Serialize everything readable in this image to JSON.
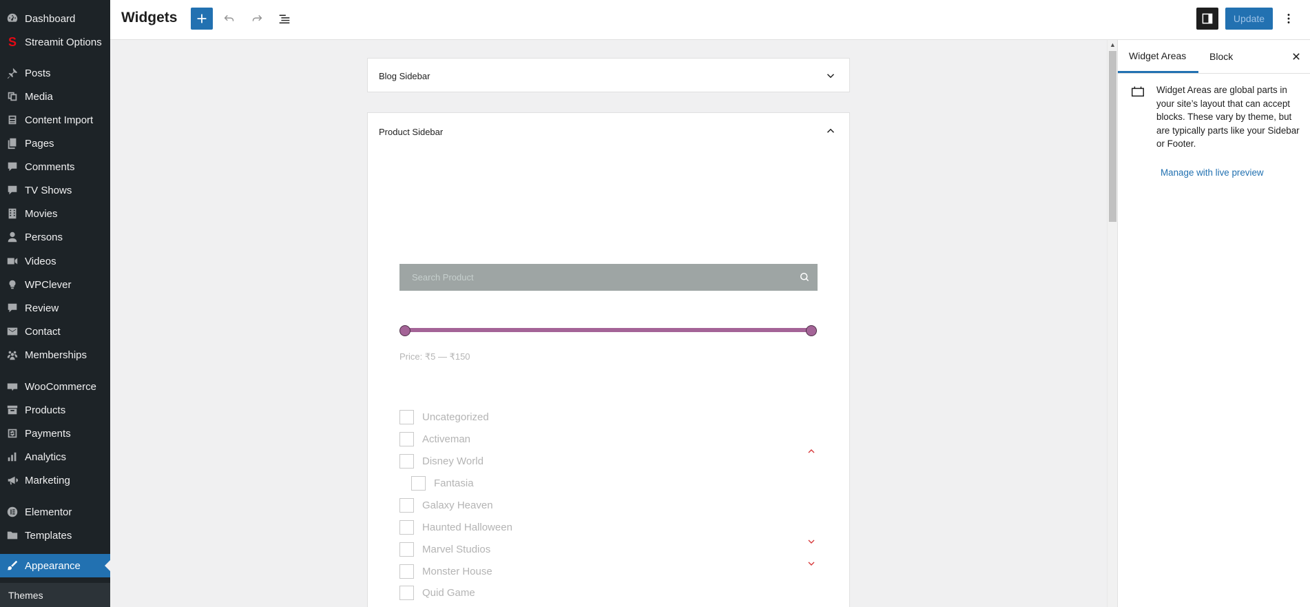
{
  "sidebar": {
    "items": [
      {
        "label": "Dashboard",
        "icon": "dashboard-icon"
      },
      {
        "label": "Streamit Options",
        "icon": "streamit-s-icon"
      },
      {
        "label": "Posts",
        "icon": "pin-icon"
      },
      {
        "label": "Media",
        "icon": "media-icon"
      },
      {
        "label": "Content Import",
        "icon": "import-icon"
      },
      {
        "label": "Pages",
        "icon": "pages-icon"
      },
      {
        "label": "Comments",
        "icon": "comment-icon"
      },
      {
        "label": "TV Shows",
        "icon": "comment-icon"
      },
      {
        "label": "Movies",
        "icon": "film-icon"
      },
      {
        "label": "Persons",
        "icon": "person-icon"
      },
      {
        "label": "Videos",
        "icon": "video-icon"
      },
      {
        "label": "WPClever",
        "icon": "lightbulb-icon"
      },
      {
        "label": "Review",
        "icon": "comment-icon"
      },
      {
        "label": "Contact",
        "icon": "mail-icon"
      },
      {
        "label": "Memberships",
        "icon": "groups-icon"
      },
      {
        "label": "WooCommerce",
        "icon": "woo-icon"
      },
      {
        "label": "Products",
        "icon": "archive-icon"
      },
      {
        "label": "Payments",
        "icon": "dollar-icon"
      },
      {
        "label": "Analytics",
        "icon": "bar-chart-icon"
      },
      {
        "label": "Marketing",
        "icon": "megaphone-icon"
      },
      {
        "label": "Elementor",
        "icon": "elementor-icon"
      },
      {
        "label": "Templates",
        "icon": "folder-icon"
      },
      {
        "label": "Appearance",
        "icon": "paintbrush-icon",
        "active": true
      }
    ],
    "submenu": {
      "label": "Themes"
    }
  },
  "header": {
    "title": "Widgets",
    "update_label": "Update"
  },
  "widget_areas": [
    {
      "title": "Blog Sidebar",
      "expanded": false
    },
    {
      "title": "Product Sidebar",
      "expanded": true
    }
  ],
  "product_sidebar": {
    "search_placeholder": "Search Product",
    "price_filter": {
      "label": "Price: ₹5 — ₹150",
      "min": 5,
      "max": 150
    },
    "categories": [
      {
        "label": "Uncategorized"
      },
      {
        "label": "Activeman"
      },
      {
        "label": "Disney World",
        "expanded": true
      },
      {
        "label": "Fantasia",
        "child": true
      },
      {
        "label": "Galaxy Heaven"
      },
      {
        "label": "Haunted Halloween"
      },
      {
        "label": "Marvel Studios",
        "has_children": true
      },
      {
        "label": "Monster House",
        "has_children": true
      },
      {
        "label": "Quid Game"
      }
    ]
  },
  "settings_panel": {
    "tabs": [
      {
        "label": "Widget Areas",
        "active": true
      },
      {
        "label": "Block",
        "active": false
      }
    ],
    "description": "Widget Areas are global parts in your site’s layout that can accept blocks. These vary by theme, but are typically parts like your Sidebar or Footer.",
    "link_label": "Manage with live preview"
  },
  "colors": {
    "admin_bg": "#1d2327",
    "accent": "#2271b1",
    "slider": "#a46497",
    "search_bg": "#9ea5a4",
    "category_toggle": "#d63638"
  }
}
